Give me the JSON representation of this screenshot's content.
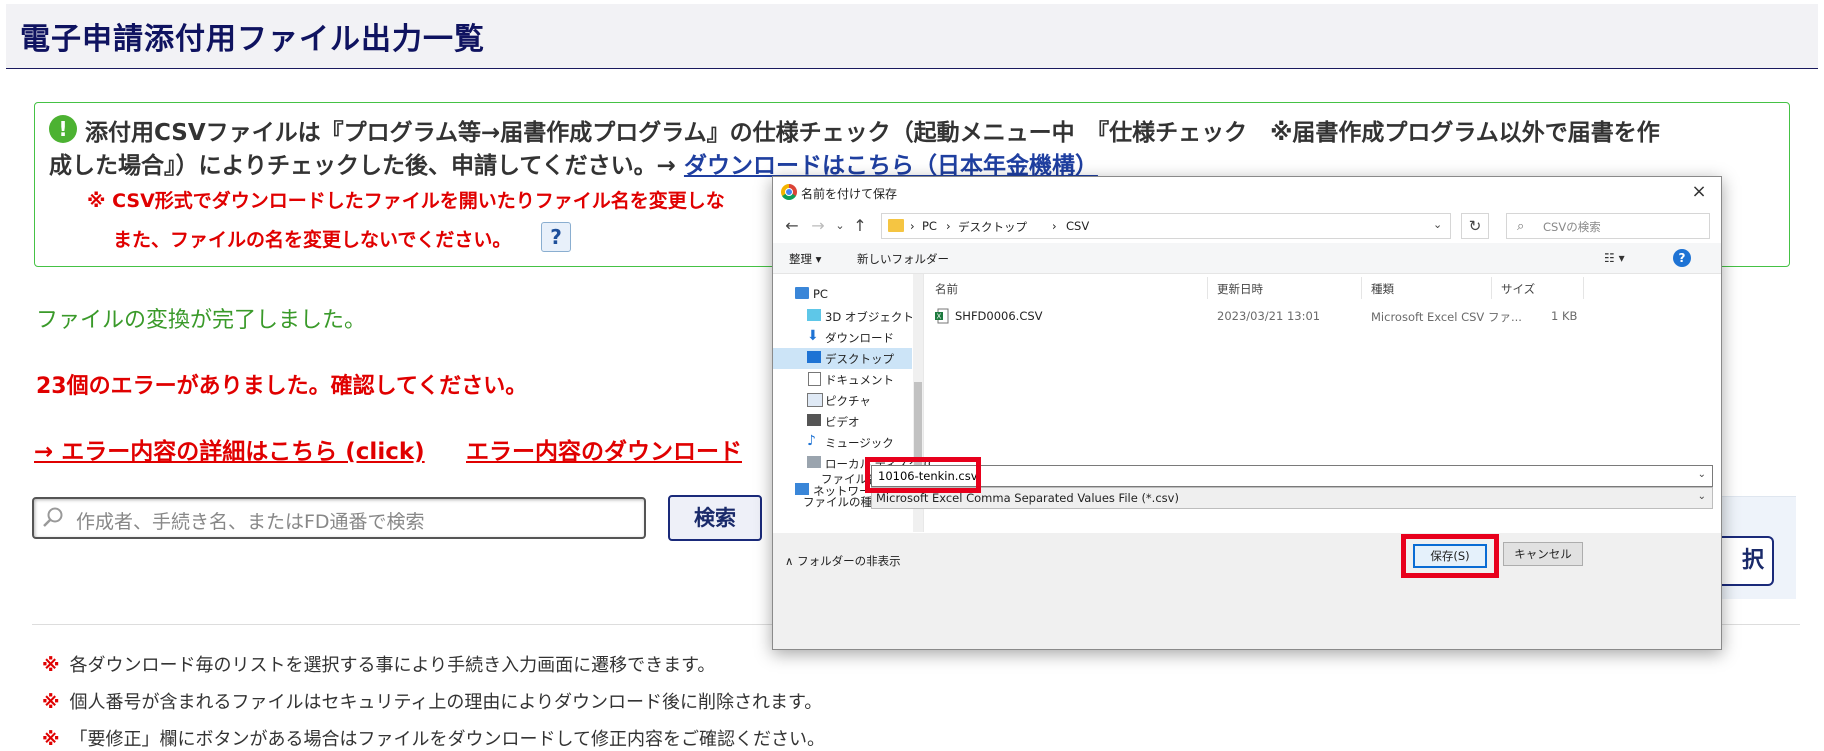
{
  "page": {
    "title": "電子申請添付用ファイル出力一覧",
    "notice": {
      "line1": "添付用CSVファイルは『プログラム等→届書作成プログラム』の仕様チェック（起動メニュー中　『仕様チェック　※届書作成プログラム以外で届書を作",
      "line2_prefix": "成した場合』）によりチェックした後、申請してください。→ ",
      "line2_link": "ダウンロードはこちら（日本年金機構）",
      "warn1": "※ CSV形式でダウンロードしたファイルを開いたりファイル名を変更しな",
      "warn2": "また、ファイルの名を変更しないでください。",
      "help": "?",
      "exclamation": "!"
    },
    "converted": "ファイルの変換が完了しました。",
    "errors": "23個のエラーがありました。確認してください。",
    "error_detail_link": "→ エラー内容の詳細はこちら (click)",
    "error_download_link": "エラー内容のダウンロード",
    "search_placeholder": "作成者、手続き名、またはFD通番で検索",
    "search_button": "検索",
    "right_button": "択",
    "notes": [
      {
        "mark": "※",
        "text": "各ダウンロード毎のリストを選択する事により手続き入力画面に遷移できます。"
      },
      {
        "mark": "※",
        "text": "個人番号が含まれるファイルはセキュリティ上の理由によりダウンロード後に削除されます。"
      },
      {
        "mark": "※",
        "text": "「要修正」欄にボタンがある場合はファイルをダウンロードして修正内容をご確認ください。"
      }
    ]
  },
  "dialog": {
    "title": "名前を付けて保存",
    "close": "×",
    "nav": {
      "back": "←",
      "forward": "→",
      "recent": "⌄",
      "up": "↑"
    },
    "breadcrumb": [
      "PC",
      "デスクトップ",
      "CSV"
    ],
    "separator": "›",
    "search_placeholder": "CSVの検索",
    "toolbar": {
      "organize": "整理 ▾",
      "new_folder": "新しいフォルダー",
      "view": "☷ ▾",
      "help": "?"
    },
    "sidebar": [
      {
        "label": "PC",
        "icon": "pc-icon"
      },
      {
        "label": "3D オブジェクト",
        "icon": "3d-objects-icon"
      },
      {
        "label": "ダウンロード",
        "icon": "download-icon"
      },
      {
        "label": "デスクトップ",
        "icon": "desktop-icon",
        "selected": true
      },
      {
        "label": "ドキュメント",
        "icon": "document-icon"
      },
      {
        "label": "ピクチャ",
        "icon": "pictures-icon"
      },
      {
        "label": "ビデオ",
        "icon": "video-icon"
      },
      {
        "label": "ミュージック",
        "icon": "music-icon"
      },
      {
        "label": "ローカル ディスク (C",
        "icon": "disk-icon"
      },
      {
        "label": "ネットワーク",
        "icon": "network-icon"
      }
    ],
    "columns": [
      "名前",
      "更新日時",
      "種類",
      "サイズ"
    ],
    "files": [
      {
        "name": "SHFD0006.CSV",
        "modified": "2023/03/21 13:01",
        "type": "Microsoft Excel CSV ファ...",
        "size": "1 KB"
      }
    ],
    "filename_label": "ファイル名(N):",
    "filename_value": "10106-tenkin.csv",
    "filetype_label": "ファイルの種類(T):",
    "filetype_value": "Microsoft Excel Comma Separated Values File (*.csv)",
    "hide_folders": "∧ フォルダーの非表示",
    "save": "保存(S)",
    "cancel": "キャンセル"
  },
  "colors": {
    "accent_red": "#e8001c",
    "title_navy": "#0f1360",
    "success_green": "#3a9a2a",
    "link_blue": "#1f3fa0"
  }
}
